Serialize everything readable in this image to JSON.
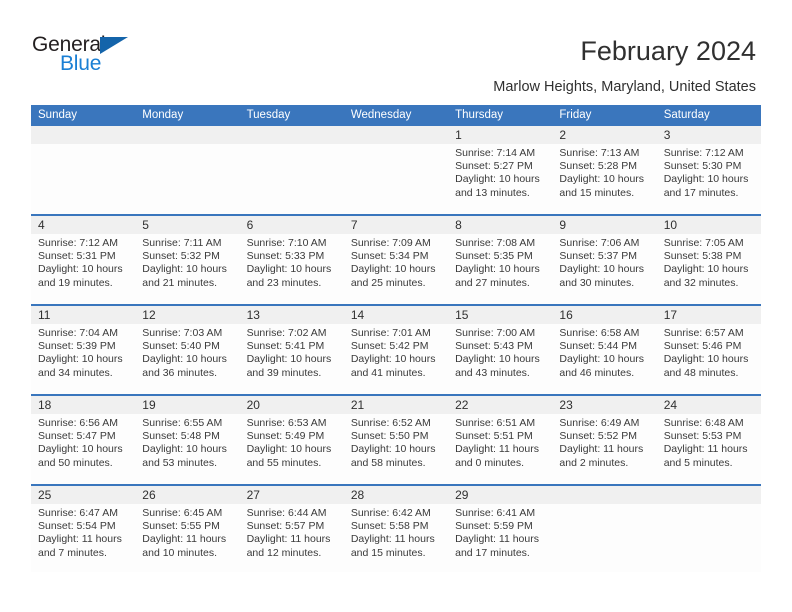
{
  "logo": {
    "word_one": "General",
    "word_two": "Blue",
    "triangle_color": "#1464aa",
    "blue_color": "#1a7fd4"
  },
  "header": {
    "title": "February 2024",
    "subtitle": "Marlow Heights, Maryland, United States",
    "accent_color": "#3a76bd",
    "numband_color": "#f0f0f0"
  },
  "calendar": {
    "weekday_headers": [
      "Sunday",
      "Monday",
      "Tuesday",
      "Wednesday",
      "Thursday",
      "Friday",
      "Saturday"
    ],
    "weeks": [
      [
        {
          "day": "",
          "lines": []
        },
        {
          "day": "",
          "lines": []
        },
        {
          "day": "",
          "lines": []
        },
        {
          "day": "",
          "lines": []
        },
        {
          "day": "1",
          "lines": [
            "Sunrise: 7:14 AM",
            "Sunset: 5:27 PM",
            "Daylight: 10 hours",
            "and 13 minutes."
          ]
        },
        {
          "day": "2",
          "lines": [
            "Sunrise: 7:13 AM",
            "Sunset: 5:28 PM",
            "Daylight: 10 hours",
            "and 15 minutes."
          ]
        },
        {
          "day": "3",
          "lines": [
            "Sunrise: 7:12 AM",
            "Sunset: 5:30 PM",
            "Daylight: 10 hours",
            "and 17 minutes."
          ]
        }
      ],
      [
        {
          "day": "4",
          "lines": [
            "Sunrise: 7:12 AM",
            "Sunset: 5:31 PM",
            "Daylight: 10 hours",
            "and 19 minutes."
          ]
        },
        {
          "day": "5",
          "lines": [
            "Sunrise: 7:11 AM",
            "Sunset: 5:32 PM",
            "Daylight: 10 hours",
            "and 21 minutes."
          ]
        },
        {
          "day": "6",
          "lines": [
            "Sunrise: 7:10 AM",
            "Sunset: 5:33 PM",
            "Daylight: 10 hours",
            "and 23 minutes."
          ]
        },
        {
          "day": "7",
          "lines": [
            "Sunrise: 7:09 AM",
            "Sunset: 5:34 PM",
            "Daylight: 10 hours",
            "and 25 minutes."
          ]
        },
        {
          "day": "8",
          "lines": [
            "Sunrise: 7:08 AM",
            "Sunset: 5:35 PM",
            "Daylight: 10 hours",
            "and 27 minutes."
          ]
        },
        {
          "day": "9",
          "lines": [
            "Sunrise: 7:06 AM",
            "Sunset: 5:37 PM",
            "Daylight: 10 hours",
            "and 30 minutes."
          ]
        },
        {
          "day": "10",
          "lines": [
            "Sunrise: 7:05 AM",
            "Sunset: 5:38 PM",
            "Daylight: 10 hours",
            "and 32 minutes."
          ]
        }
      ],
      [
        {
          "day": "11",
          "lines": [
            "Sunrise: 7:04 AM",
            "Sunset: 5:39 PM",
            "Daylight: 10 hours",
            "and 34 minutes."
          ]
        },
        {
          "day": "12",
          "lines": [
            "Sunrise: 7:03 AM",
            "Sunset: 5:40 PM",
            "Daylight: 10 hours",
            "and 36 minutes."
          ]
        },
        {
          "day": "13",
          "lines": [
            "Sunrise: 7:02 AM",
            "Sunset: 5:41 PM",
            "Daylight: 10 hours",
            "and 39 minutes."
          ]
        },
        {
          "day": "14",
          "lines": [
            "Sunrise: 7:01 AM",
            "Sunset: 5:42 PM",
            "Daylight: 10 hours",
            "and 41 minutes."
          ]
        },
        {
          "day": "15",
          "lines": [
            "Sunrise: 7:00 AM",
            "Sunset: 5:43 PM",
            "Daylight: 10 hours",
            "and 43 minutes."
          ]
        },
        {
          "day": "16",
          "lines": [
            "Sunrise: 6:58 AM",
            "Sunset: 5:44 PM",
            "Daylight: 10 hours",
            "and 46 minutes."
          ]
        },
        {
          "day": "17",
          "lines": [
            "Sunrise: 6:57 AM",
            "Sunset: 5:46 PM",
            "Daylight: 10 hours",
            "and 48 minutes."
          ]
        }
      ],
      [
        {
          "day": "18",
          "lines": [
            "Sunrise: 6:56 AM",
            "Sunset: 5:47 PM",
            "Daylight: 10 hours",
            "and 50 minutes."
          ]
        },
        {
          "day": "19",
          "lines": [
            "Sunrise: 6:55 AM",
            "Sunset: 5:48 PM",
            "Daylight: 10 hours",
            "and 53 minutes."
          ]
        },
        {
          "day": "20",
          "lines": [
            "Sunrise: 6:53 AM",
            "Sunset: 5:49 PM",
            "Daylight: 10 hours",
            "and 55 minutes."
          ]
        },
        {
          "day": "21",
          "lines": [
            "Sunrise: 6:52 AM",
            "Sunset: 5:50 PM",
            "Daylight: 10 hours",
            "and 58 minutes."
          ]
        },
        {
          "day": "22",
          "lines": [
            "Sunrise: 6:51 AM",
            "Sunset: 5:51 PM",
            "Daylight: 11 hours",
            "and 0 minutes."
          ]
        },
        {
          "day": "23",
          "lines": [
            "Sunrise: 6:49 AM",
            "Sunset: 5:52 PM",
            "Daylight: 11 hours",
            "and 2 minutes."
          ]
        },
        {
          "day": "24",
          "lines": [
            "Sunrise: 6:48 AM",
            "Sunset: 5:53 PM",
            "Daylight: 11 hours",
            "and 5 minutes."
          ]
        }
      ],
      [
        {
          "day": "25",
          "lines": [
            "Sunrise: 6:47 AM",
            "Sunset: 5:54 PM",
            "Daylight: 11 hours",
            "and 7 minutes."
          ]
        },
        {
          "day": "26",
          "lines": [
            "Sunrise: 6:45 AM",
            "Sunset: 5:55 PM",
            "Daylight: 11 hours",
            "and 10 minutes."
          ]
        },
        {
          "day": "27",
          "lines": [
            "Sunrise: 6:44 AM",
            "Sunset: 5:57 PM",
            "Daylight: 11 hours",
            "and 12 minutes."
          ]
        },
        {
          "day": "28",
          "lines": [
            "Sunrise: 6:42 AM",
            "Sunset: 5:58 PM",
            "Daylight: 11 hours",
            "and 15 minutes."
          ]
        },
        {
          "day": "29",
          "lines": [
            "Sunrise: 6:41 AM",
            "Sunset: 5:59 PM",
            "Daylight: 11 hours",
            "and 17 minutes."
          ]
        },
        {
          "day": "",
          "lines": []
        },
        {
          "day": "",
          "lines": []
        }
      ]
    ]
  }
}
